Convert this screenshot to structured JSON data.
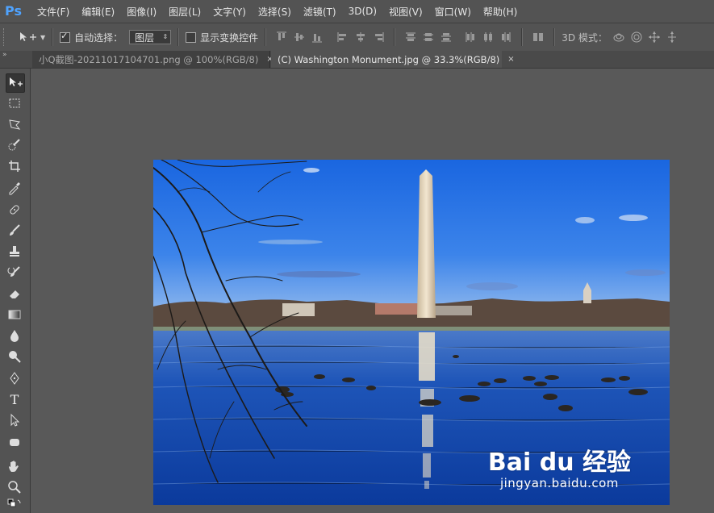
{
  "app": {
    "logo": "Ps"
  },
  "menu": [
    "文件(F)",
    "编辑(E)",
    "图像(I)",
    "图层(L)",
    "文字(Y)",
    "选择(S)",
    "滤镜(T)",
    "3D(D)",
    "视图(V)",
    "窗口(W)",
    "帮助(H)"
  ],
  "options": {
    "auto_select_label": "自动选择：",
    "auto_select_checked": true,
    "auto_select_value": "图层",
    "show_transform_label": "显示变换控件",
    "show_transform_checked": false,
    "mode_3d_label": "3D 模式："
  },
  "tabs": [
    {
      "label": "小Q截图-20211017104701.png @ 100%(RGB/8)",
      "close": "×",
      "active": false
    },
    {
      "label": "(C) Washington Monument.jpg @ 33.3%(RGB/8)",
      "close": "×",
      "active": true
    }
  ],
  "tools": [
    "move-tool",
    "marquee-tool",
    "lasso-tool",
    "quick-select-tool",
    "crop-tool",
    "eyedropper-tool",
    "healing-brush-tool",
    "brush-tool",
    "clone-stamp-tool",
    "history-brush-tool",
    "eraser-tool",
    "gradient-tool",
    "blur-tool",
    "dodge-tool",
    "pen-tool",
    "type-tool",
    "path-select-tool",
    "shape-tool",
    "hand-tool",
    "zoom-tool"
  ],
  "type_tool_glyph": "T",
  "watermark": {
    "logo": "Bai du 经验",
    "url": "jingyan.baidu.com"
  },
  "colors": {
    "sky_top": "#1f6fe6",
    "sky_bottom": "#7fb0ea",
    "water": "#1b4fae",
    "monument": "#e8dcc4"
  }
}
